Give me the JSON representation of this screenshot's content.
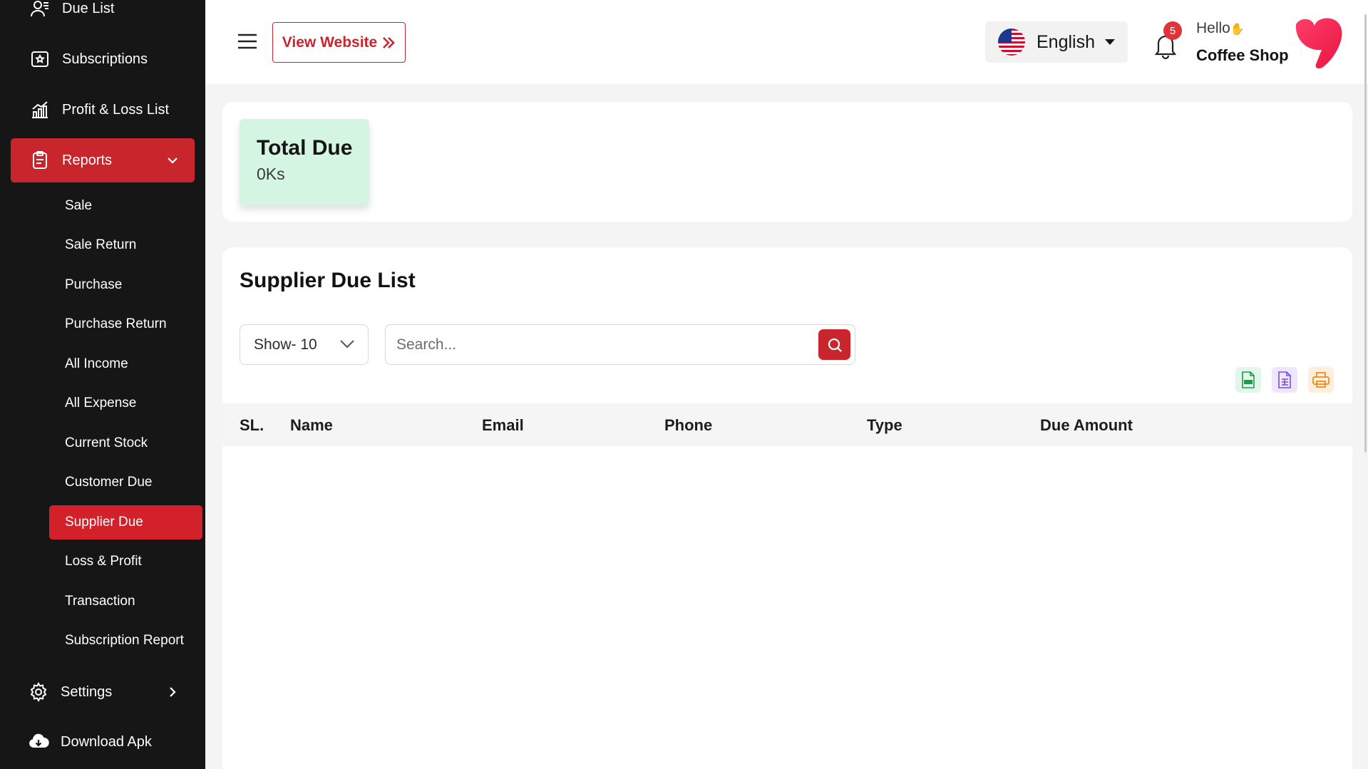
{
  "sidebar": {
    "top_items": [
      {
        "label": "Due List",
        "icon": "user-list-icon"
      },
      {
        "label": "Subscriptions",
        "icon": "subscription-icon"
      },
      {
        "label": "Profit & Loss List",
        "icon": "chart-bars-icon"
      },
      {
        "label": "Reports",
        "icon": "clipboard-icon",
        "active": true
      }
    ],
    "report_items": [
      "Sale",
      "Sale Return",
      "Purchase",
      "Purchase Return",
      "All Income",
      "All Expense",
      "Current Stock",
      "Customer Due",
      "Supplier Due",
      "Loss & Profit",
      "Transaction",
      "Subscription Report"
    ],
    "active_report": "Supplier Due",
    "bottom_items": [
      {
        "label": "Settings",
        "icon": "gear-icon"
      },
      {
        "label": "Download Apk",
        "icon": "cloud-download-icon"
      }
    ]
  },
  "header": {
    "view_website_label": "View Website",
    "language": "English",
    "notification_count": "5",
    "greeting": "Hello",
    "shop_name": "Coffee Shop"
  },
  "summary": {
    "title": "Total Due",
    "value": "0Ks"
  },
  "list": {
    "title": "Supplier Due List",
    "show_label": "Show- 10",
    "search_placeholder": "Search...",
    "columns": [
      "SL.",
      "Name",
      "Email",
      "Phone",
      "Type",
      "Due Amount"
    ],
    "rows": []
  },
  "colors": {
    "accent": "#c9252d",
    "sidebar_bg": "#161616",
    "summary_tile": "#d5f5e3"
  }
}
